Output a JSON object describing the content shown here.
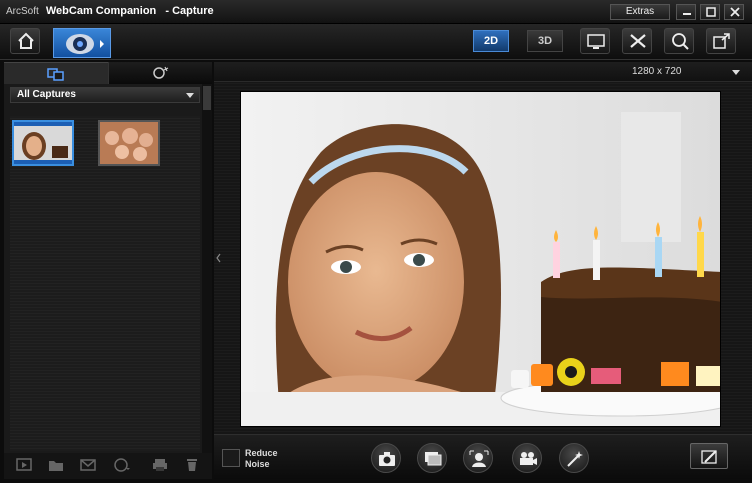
{
  "window": {
    "brand": "ArcSoft",
    "app_name": "WebCam Companion",
    "separator": "- Capture",
    "extras_label": "Extras"
  },
  "toolbar": {
    "mode_2d": "2D",
    "mode_3d": "3D"
  },
  "left_panel": {
    "filter": "All Captures",
    "thumbnails": [
      {
        "selected": true
      },
      {
        "selected": false
      }
    ]
  },
  "viewer": {
    "resolution": "1280 x 720"
  },
  "controls": {
    "reduce_noise_line1": "Reduce",
    "reduce_noise_line2": "Noise",
    "reduce_noise_checked": false
  },
  "colors": {
    "accent": "#2f6fbd",
    "selection": "#3a8fe0",
    "background": "#1a1a1a"
  }
}
